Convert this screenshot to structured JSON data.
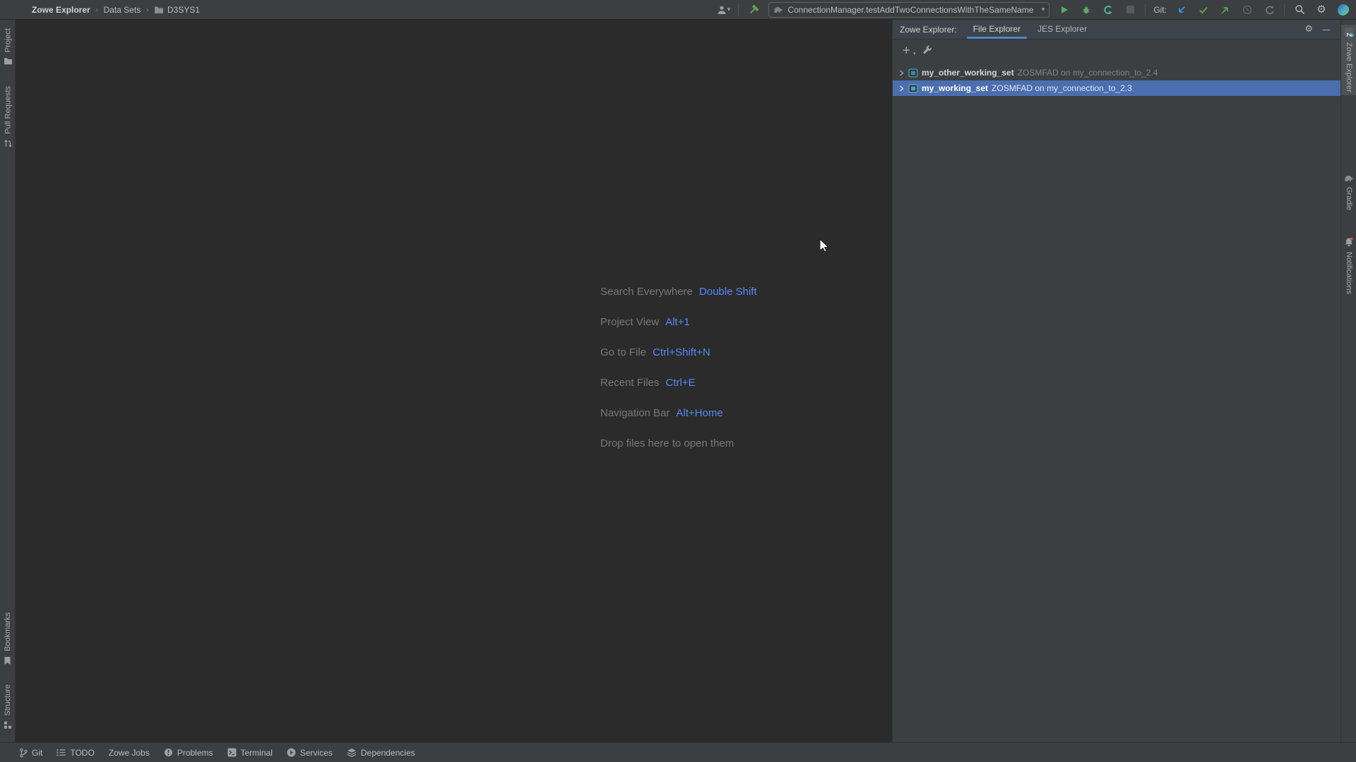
{
  "topbar": {
    "breadcrumb": [
      "Zowe Explorer",
      "Data Sets",
      "D3SYS1"
    ],
    "run_config": "ConnectionManager.testAddTwoConnectionsWithTheSameName",
    "git_label": "Git:"
  },
  "left_stripe": {
    "top": [
      "Project",
      "Pull Requests"
    ],
    "bottom": [
      "Bookmarks",
      "Structure"
    ]
  },
  "right_stripe": [
    "Zowe Explorer",
    "Gradle",
    "Notifications"
  ],
  "tool_window": {
    "title": "Zowe Explorer:",
    "tabs": [
      "File Explorer",
      "JES Explorer"
    ],
    "tree": [
      {
        "name": "my_other_working_set",
        "detail": "ZOSMFAD on my_connection_to_2.4",
        "selected": false
      },
      {
        "name": "my_working_set",
        "detail": "ZOSMFAD on my_connection_to_2.3",
        "selected": true
      }
    ]
  },
  "editor_overlay": {
    "shortcuts": [
      {
        "label": "Search Everywhere",
        "keys": "Double Shift"
      },
      {
        "label": "Project View",
        "keys": "Alt+1"
      },
      {
        "label": "Go to File",
        "keys": "Ctrl+Shift+N"
      },
      {
        "label": "Recent Files",
        "keys": "Ctrl+E"
      },
      {
        "label": "Navigation Bar",
        "keys": "Alt+Home"
      },
      {
        "label": "Drop files here to open them",
        "keys": ""
      }
    ]
  },
  "statusbar": [
    "Git",
    "TODO",
    "Zowe Jobs",
    "Problems",
    "Terminal",
    "Services",
    "Dependencies"
  ],
  "icons": {
    "gear": "⚙",
    "caret-down": "▾",
    "plus": "+",
    "minimize": "—",
    "breadcrumb-separator": "›"
  },
  "colors": {
    "panel_bg": "#3c3f41",
    "editor_bg": "#2b2b2b",
    "border": "#323232",
    "text": "#bbbbbb",
    "muted_text": "#787878",
    "selection_blue": "#4b6eaf",
    "shortcut_key_blue": "#548af7",
    "tab_underline_blue": "#4a88c7",
    "run_green": "#59a869",
    "git_update_blue": "#3b92d6",
    "workingset_icon_teal": "#4fb3c6"
  }
}
